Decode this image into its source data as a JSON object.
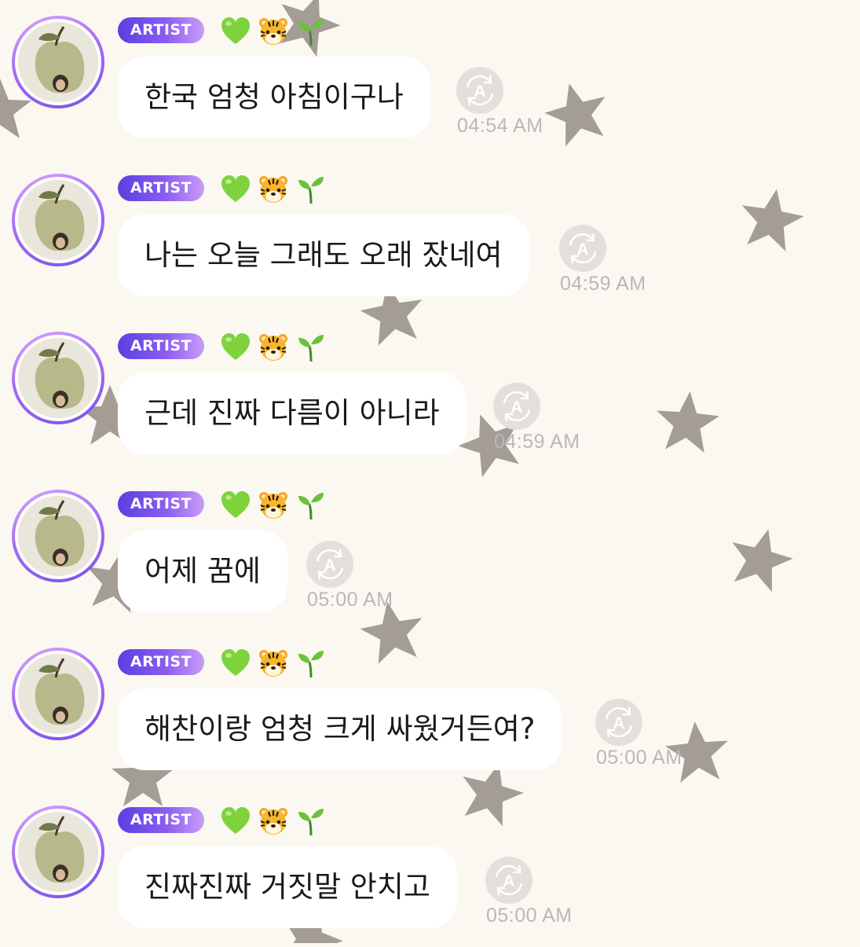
{
  "messages": [
    {
      "badge": "ARTIST",
      "emojis": [
        "green-heart-icon",
        "tiger-face-icon",
        "seedling-icon"
      ],
      "text": "한국 엄청 아침이구나",
      "time": "04:54 AM"
    },
    {
      "badge": "ARTIST",
      "emojis": [
        "green-heart-icon",
        "tiger-face-icon",
        "seedling-icon"
      ],
      "text": "나는 오늘 그래도 오래 잤네여",
      "time": "04:59 AM"
    },
    {
      "badge": "ARTIST",
      "emojis": [
        "green-heart-icon",
        "tiger-face-icon",
        "seedling-icon"
      ],
      "text": "근데 진짜 다름이 아니라",
      "time": "04:59 AM"
    },
    {
      "badge": "ARTIST",
      "emojis": [
        "green-heart-icon",
        "tiger-face-icon",
        "seedling-icon"
      ],
      "text": "어제 꿈에",
      "time": "05:00 AM"
    },
    {
      "badge": "ARTIST",
      "emojis": [
        "green-heart-icon",
        "tiger-face-icon",
        "seedling-icon"
      ],
      "text": "해찬이랑 엄청 크게 싸웠거든여?",
      "time": "05:00 AM"
    },
    {
      "badge": "ARTIST",
      "emojis": [
        "green-heart-icon",
        "tiger-face-icon",
        "seedling-icon"
      ],
      "text": "진짜진짜 거짓말 안치고",
      "time": "05:00 AM"
    }
  ],
  "colors": {
    "background": "#fbf8f1",
    "badge_start": "#5b3fe0",
    "badge_end": "#c99cf7",
    "bubble": "#ffffff",
    "timestamp": "#b8b8b8",
    "star": "#a39d96"
  }
}
